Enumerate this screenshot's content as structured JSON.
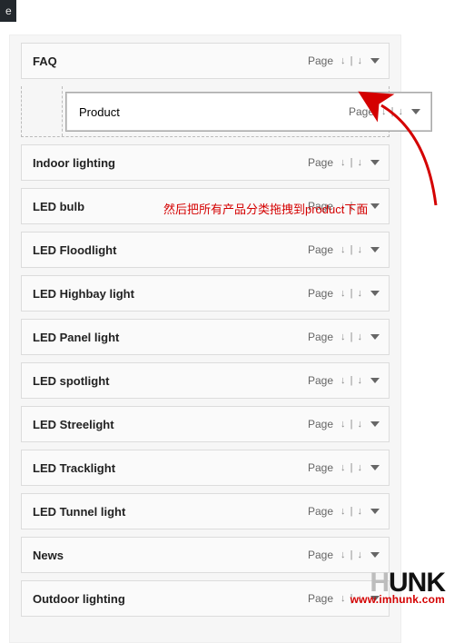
{
  "topbar_fragment": "e",
  "type_label": "Page",
  "sub_indicator": "↓ | ↓",
  "annotation_text": "然后把所有产品分类拖拽到product下面",
  "watermark": {
    "main": "HUNK",
    "url": "www.imhunk.com"
  },
  "nested_item": {
    "title": "Product"
  },
  "items": [
    {
      "title": "FAQ"
    },
    {
      "title": "Indoor lighting"
    },
    {
      "title": "LED bulb"
    },
    {
      "title": "LED Floodlight"
    },
    {
      "title": "LED Highbay light"
    },
    {
      "title": "LED Panel light"
    },
    {
      "title": "LED spotlight"
    },
    {
      "title": "LED Streelight"
    },
    {
      "title": "LED Tracklight"
    },
    {
      "title": "LED Tunnel light"
    },
    {
      "title": "News"
    },
    {
      "title": "Outdoor lighting"
    }
  ]
}
